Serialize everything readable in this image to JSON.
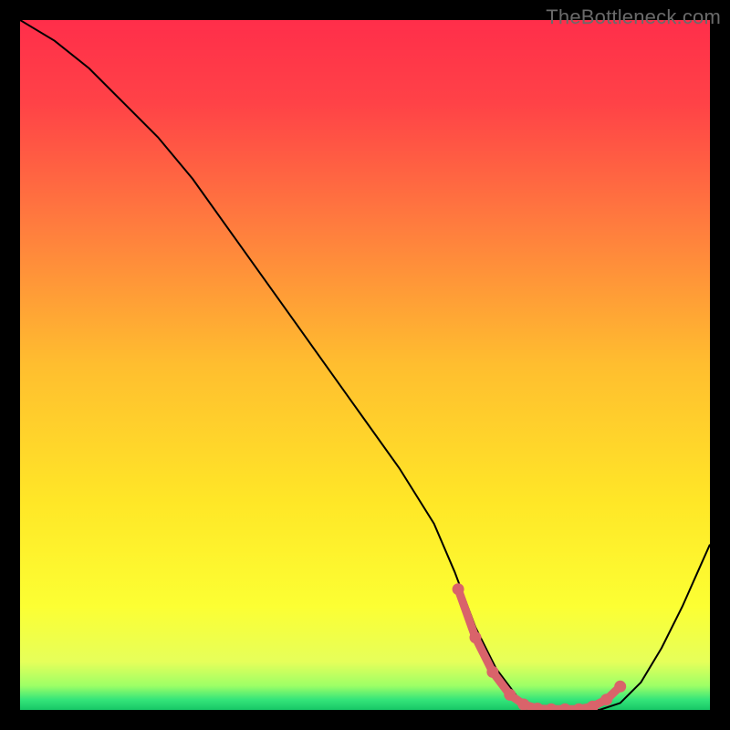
{
  "watermark": "TheBottleneck.com",
  "chart_data": {
    "type": "line",
    "title": "",
    "xlabel": "",
    "ylabel": "",
    "xlim": [
      0,
      100
    ],
    "ylim": [
      0,
      100
    ],
    "grid": false,
    "series": [
      {
        "name": "curve",
        "x": [
          0,
          5,
          10,
          15,
          20,
          25,
          30,
          35,
          40,
          45,
          50,
          55,
          60,
          63,
          66,
          69,
          72,
          75,
          78,
          81,
          84,
          87,
          90,
          93,
          96,
          100
        ],
        "y": [
          100,
          97,
          93,
          88,
          83,
          77,
          70,
          63,
          56,
          49,
          42,
          35,
          27,
          20,
          12,
          6,
          2,
          0,
          0,
          0,
          0,
          1,
          4,
          9,
          15,
          24
        ]
      }
    ],
    "highlight": {
      "name": "dotted-min",
      "x": [
        63.5,
        66.0,
        68.5,
        71.0,
        73.0,
        75.0,
        77.0,
        79.0,
        81.0,
        83.0,
        85.0,
        87.0
      ],
      "y": [
        17.5,
        10.5,
        5.5,
        2.2,
        0.8,
        0.2,
        0.1,
        0.1,
        0.1,
        0.5,
        1.5,
        3.4
      ]
    },
    "gradient_stops": [
      {
        "offset": 0.0,
        "color": "#ff2e4a"
      },
      {
        "offset": 0.12,
        "color": "#ff4247"
      },
      {
        "offset": 0.3,
        "color": "#ff7d3e"
      },
      {
        "offset": 0.5,
        "color": "#ffbe2f"
      },
      {
        "offset": 0.7,
        "color": "#ffe727"
      },
      {
        "offset": 0.85,
        "color": "#fcff33"
      },
      {
        "offset": 0.93,
        "color": "#e6ff5a"
      },
      {
        "offset": 0.965,
        "color": "#9dff66"
      },
      {
        "offset": 0.985,
        "color": "#35e57a"
      },
      {
        "offset": 1.0,
        "color": "#17c766"
      }
    ],
    "curve_color": "#000000",
    "highlight_color": "#d9636a"
  }
}
